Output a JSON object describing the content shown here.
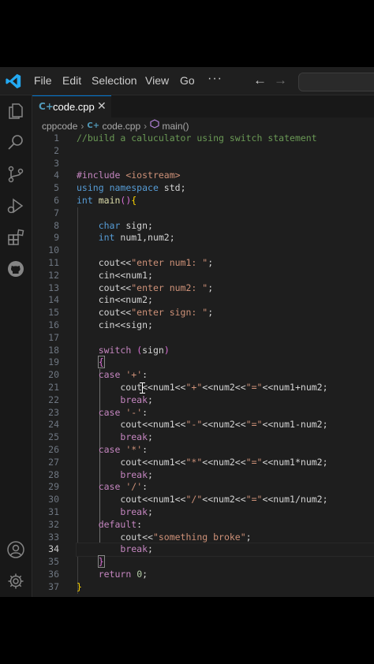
{
  "menu": {
    "file": "File",
    "edit": "Edit",
    "selection": "Selection",
    "view": "View",
    "go": "Go",
    "more": "···"
  },
  "nav": {
    "back": "←",
    "forward": "→"
  },
  "tab": {
    "label": "code.cpp",
    "close": "✕"
  },
  "breadcrumb": {
    "folder": "cppcode",
    "file": "code.cpp",
    "symbol": "main()"
  },
  "activity_icons": [
    "files-icon",
    "search-icon",
    "source-control-icon",
    "run-debug-icon",
    "extensions-icon",
    "github-icon",
    "account-icon",
    "settings-gear-icon"
  ],
  "active_line": 34,
  "lines": [
    {
      "n": "1",
      "t": "//build a caluculator using switch statement"
    },
    {
      "n": "2",
      "t": ""
    },
    {
      "n": "3",
      "t": ""
    },
    {
      "n": "4",
      "t": "#include <iostream>"
    },
    {
      "n": "5",
      "t": "using namespace std;"
    },
    {
      "n": "6",
      "t": "int main(){"
    },
    {
      "n": "7",
      "t": ""
    },
    {
      "n": "8",
      "t": "    char sign;"
    },
    {
      "n": "9",
      "t": "    int num1,num2;"
    },
    {
      "n": "10",
      "t": ""
    },
    {
      "n": "11",
      "t": "    cout<<\"enter num1: \";"
    },
    {
      "n": "12",
      "t": "    cin<<num1;"
    },
    {
      "n": "13",
      "t": "    cout<<\"enter num2: \";"
    },
    {
      "n": "14",
      "t": "    cin<<num2;"
    },
    {
      "n": "15",
      "t": "    cout<<\"enter sign: \";"
    },
    {
      "n": "16",
      "t": "    cin<<sign;"
    },
    {
      "n": "17",
      "t": ""
    },
    {
      "n": "18",
      "t": "    switch (sign)"
    },
    {
      "n": "19",
      "t": "    {"
    },
    {
      "n": "20",
      "t": "    case '+':"
    },
    {
      "n": "21",
      "t": "        cout<<num1<<\"+\"<<num2<<\"=\"<<num1+num2;"
    },
    {
      "n": "22",
      "t": "        break;"
    },
    {
      "n": "23",
      "t": "    case '-':"
    },
    {
      "n": "24",
      "t": "        cout<<num1<<\"-\"<<num2<<\"=\"<<num1-num2;"
    },
    {
      "n": "25",
      "t": "        break;"
    },
    {
      "n": "26",
      "t": "    case '*':"
    },
    {
      "n": "27",
      "t": "        cout<<num1<<\"*\"<<num2<<\"=\"<<num1*num2;"
    },
    {
      "n": "28",
      "t": "        break;"
    },
    {
      "n": "29",
      "t": "    case '/':"
    },
    {
      "n": "30",
      "t": "        cout<<num1<<\"/\"<<num2<<\"=\"<<num1/num2;"
    },
    {
      "n": "31",
      "t": "        break;"
    },
    {
      "n": "32",
      "t": "    default:"
    },
    {
      "n": "33",
      "t": "        cout<<\"something broke\";"
    },
    {
      "n": "34",
      "t": "        break;"
    },
    {
      "n": "35",
      "t": "    }"
    },
    {
      "n": "36",
      "t": "    return 0;"
    },
    {
      "n": "37",
      "t": "}"
    }
  ]
}
